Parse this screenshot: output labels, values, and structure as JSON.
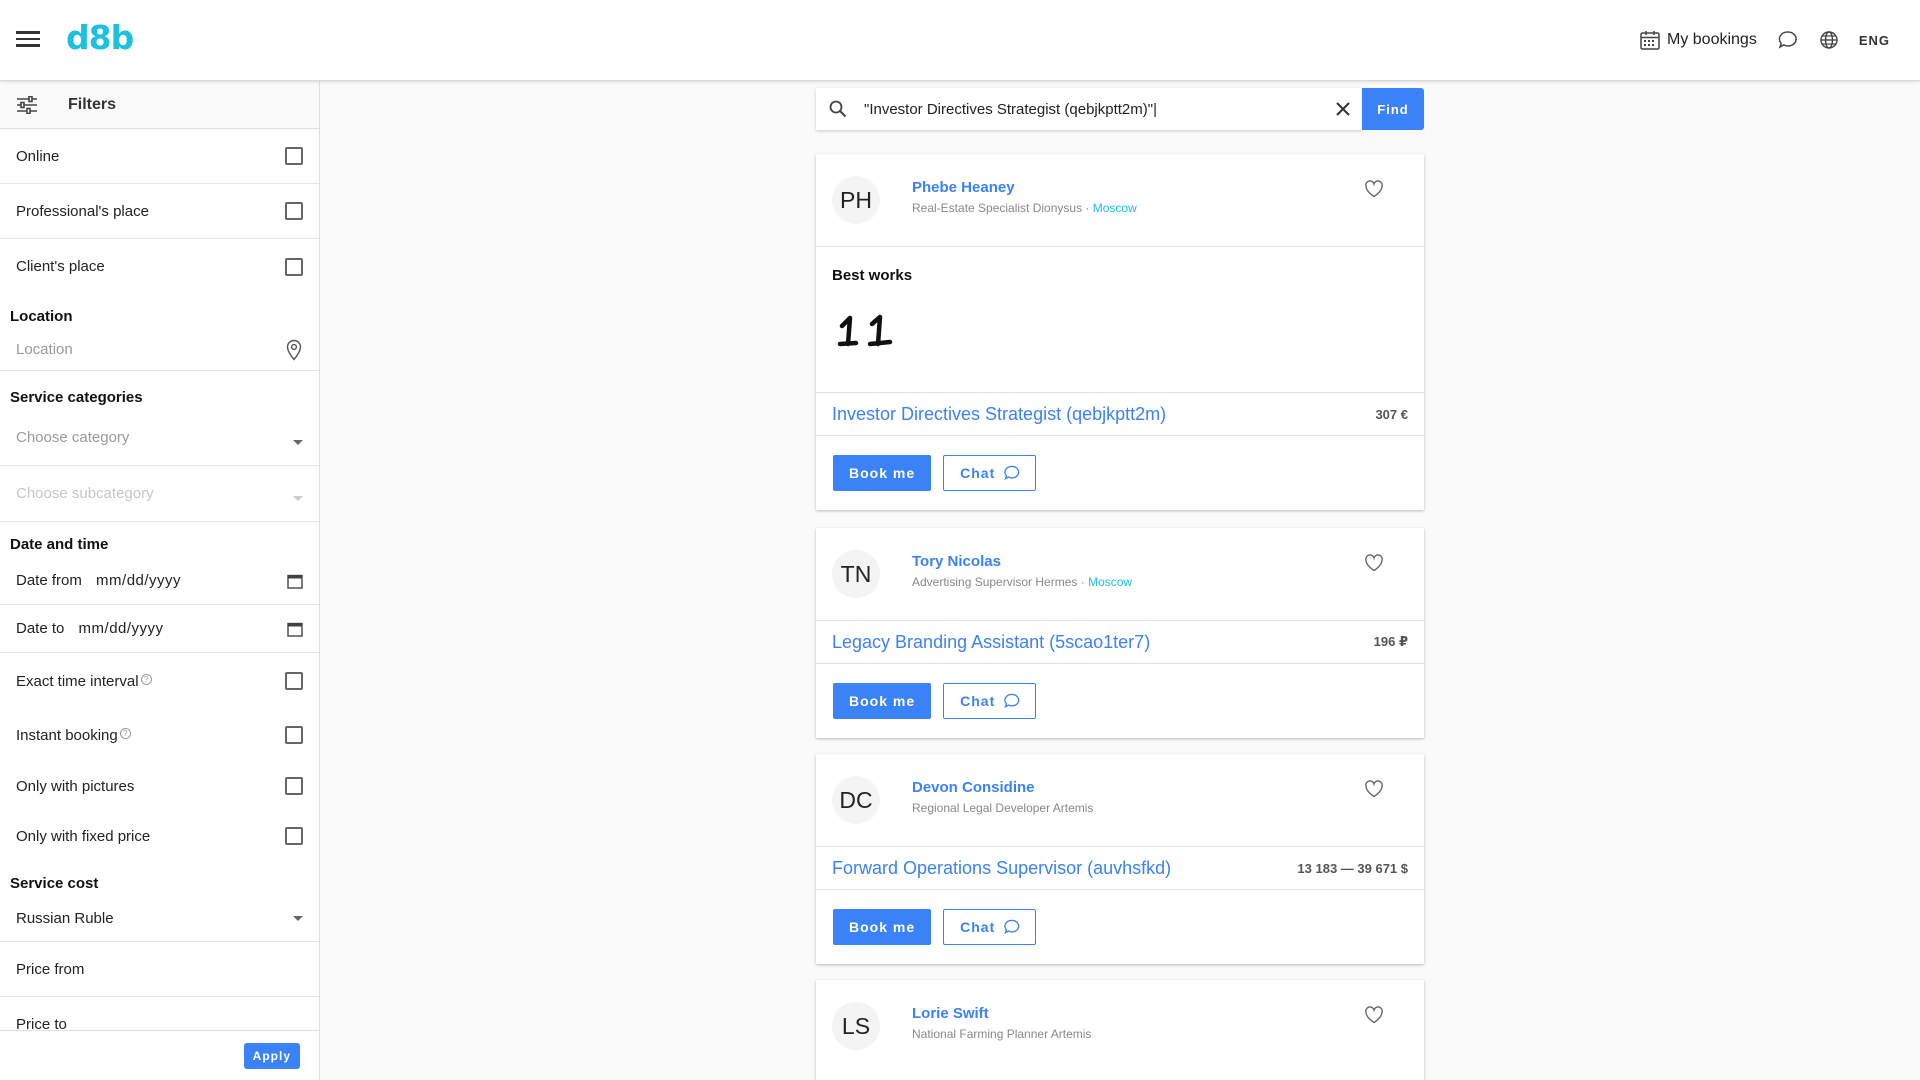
{
  "header": {
    "logo": "d8b",
    "bookings_label": "My bookings",
    "language": "ENG"
  },
  "sidebar": {
    "filters_label": "Filters",
    "place_options": [
      {
        "label": "Online"
      },
      {
        "label": "Professional's place"
      },
      {
        "label": "Client's place"
      }
    ],
    "location_title": "Location",
    "location_placeholder": "Location",
    "service_categories_title": "Service categories",
    "category_placeholder": "Choose category",
    "subcategory_placeholder": "Choose subcategory",
    "date_time_title": "Date and time",
    "date_from_label": "Date from",
    "date_from_value": "mm/dd/yyyy",
    "date_to_label": "Date to",
    "date_to_value": "mm/dd/yyyy",
    "exact_time_label": "Exact time interval",
    "instant_booking_label": "Instant booking",
    "only_pictures_label": "Only with pictures",
    "only_fixed_price_label": "Only with fixed price",
    "service_cost_title": "Service cost",
    "currency": "Russian Ruble",
    "price_from_label": "Price from",
    "price_to_label": "Price to",
    "apply_label": "Apply"
  },
  "search": {
    "query": "\"Investor Directives Strategist (qebjkptt2m)\"|",
    "find_label": "Find"
  },
  "results": [
    {
      "initials": "PH",
      "name": "Phebe Heaney",
      "role": "Real-Estate Specialist Dionysus",
      "separator": " · ",
      "city": "Moscow",
      "best_works_title": "Best works",
      "service": "Investor Directives Strategist (qebjkptt2m)",
      "price": "307 €",
      "book_label": "Book me",
      "chat_label": "Chat"
    },
    {
      "initials": "TN",
      "name": "Tory Nicolas",
      "role": "Advertising Supervisor Hermes",
      "separator": " · ",
      "city": "Moscow",
      "service": "Legacy Branding Assistant (5scao1ter7)",
      "price": "196 ₽",
      "book_label": "Book me",
      "chat_label": "Chat"
    },
    {
      "initials": "DC",
      "name": "Devon Considine",
      "role": "Regional Legal Developer Artemis",
      "service": "Forward Operations Supervisor (auvhsfkd)",
      "price": "13 183 — 39 671 $",
      "book_label": "Book me",
      "chat_label": "Chat"
    },
    {
      "initials": "LS",
      "name": "Lorie Swift",
      "role": "National Farming Planner Artemis"
    }
  ],
  "colors": {
    "accent": "#3b82f6",
    "brand": "#1ec0e0"
  }
}
